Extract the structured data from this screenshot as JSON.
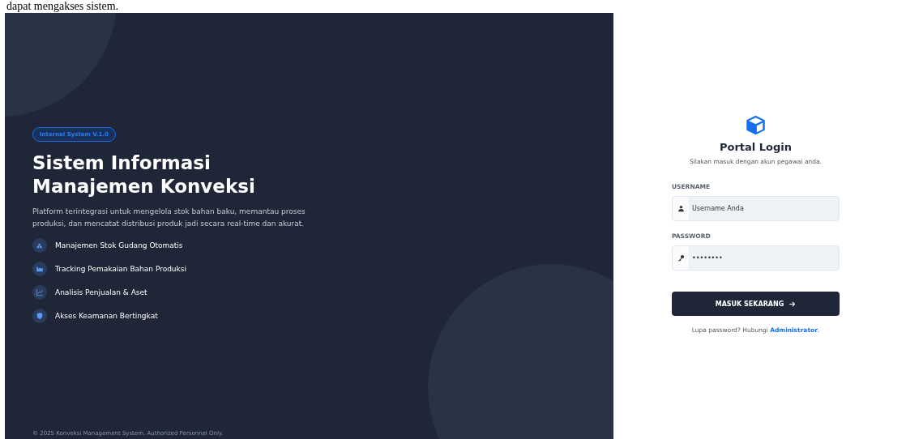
{
  "page_note": "dapat mengakses sistem.",
  "hero": {
    "badge": "Internal System V.1.0",
    "title_lines": [
      "Sistem Informasi",
      "Manajemen Konveksi"
    ],
    "description": "Platform terintegrasi untuk mengelola stok bahan baku, memantau proses produksi, dan mencatat distribusi produk jadi secara real-time dan akurat.",
    "features": [
      {
        "kind": "warehouse",
        "label": "Manajemen Stok Gudang Otomatis"
      },
      {
        "kind": "factory",
        "label": "Tracking Pemakaian Bahan Produksi"
      },
      {
        "kind": "chart",
        "label": "Analisis Penjualan & Aset"
      },
      {
        "kind": "shield",
        "label": "Akses Keamanan Bertingkat"
      }
    ],
    "footer": "© 2025 Konveksi Management System. Authorized Personnel Only."
  },
  "login": {
    "title": "Portal Login",
    "subtitle": "Silakan masuk dengan akun pegawai anda.",
    "fields": [
      {
        "kind": "user",
        "label": "USERNAME",
        "placeholder": "Username Anda"
      },
      {
        "kind": "key",
        "label": "PASSWORD",
        "value": "••••••••"
      }
    ],
    "submit": "MASUK SEKARANG",
    "help_text": "Lupa password? Hubungi ",
    "help_link": "Administrator",
    "help_end": "."
  }
}
